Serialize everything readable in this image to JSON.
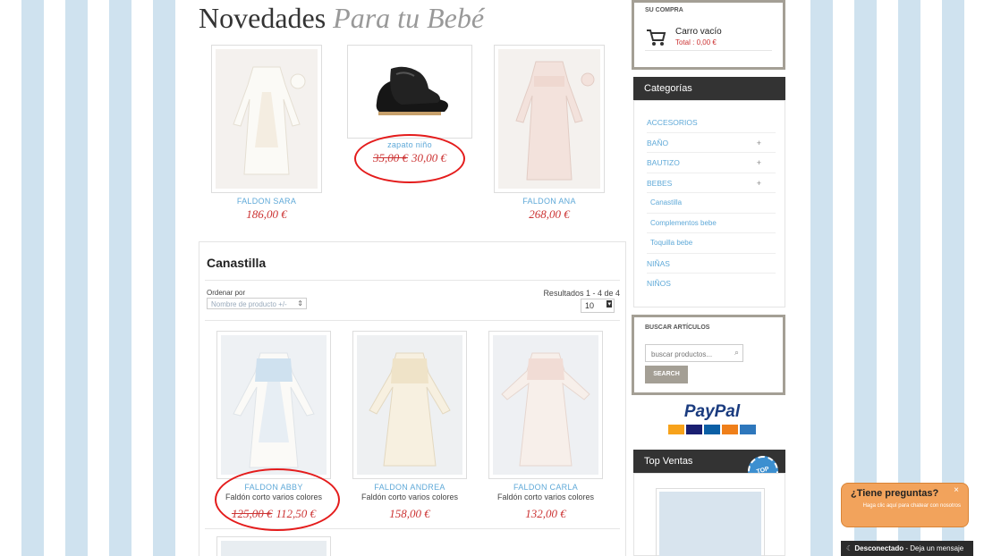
{
  "heading": {
    "main": "Novedades",
    "accent": "Para tu Bebé"
  },
  "featured": [
    {
      "name": "FALDON SARA",
      "price": "186,00 €",
      "old_price": ""
    },
    {
      "name": "zapato niño",
      "price": "30,00 €",
      "old_price": "35,00 €"
    },
    {
      "name": "FALDON ANA",
      "price": "268,00 €",
      "old_price": ""
    }
  ],
  "category": {
    "title": "Canastilla",
    "sort_label": "Ordenar por",
    "sort_value": "Nombre de producto +/-",
    "results": "Resultados 1 - 4 de 4",
    "per_page": "10",
    "products": [
      {
        "name": "FALDON ABBY",
        "desc": "Faldón corto varios colores",
        "price": "112,50 €",
        "old_price": "125,00 €"
      },
      {
        "name": "FALDON ANDREA",
        "desc": "Faldón corto varios colores",
        "price": "158,00 €",
        "old_price": ""
      },
      {
        "name": "FALDON CARLA",
        "desc": "Faldón corto varios colores",
        "price": "132,00 €",
        "old_price": ""
      }
    ]
  },
  "cart": {
    "title": "SU COMPRA",
    "status": "Carro vacío",
    "total": "Total : 0,00 €"
  },
  "categories": {
    "title": "Categorías",
    "items": [
      {
        "label": "ACCESORIOS",
        "expand": ""
      },
      {
        "label": "BAÑO",
        "expand": "+"
      },
      {
        "label": "BAUTIZO",
        "expand": "+"
      },
      {
        "label": "BEBES",
        "expand": "+"
      },
      {
        "label": "Canastilla",
        "expand": ""
      },
      {
        "label": "Complementos bebe",
        "expand": ""
      },
      {
        "label": "Toquilla bebe",
        "expand": ""
      },
      {
        "label": "NIÑAS",
        "expand": ""
      },
      {
        "label": "NIÑOS",
        "expand": ""
      }
    ]
  },
  "search": {
    "title": "BUSCAR ARTÍCULOS",
    "placeholder": "buscar productos...",
    "button": "SEARCH"
  },
  "paypal": {
    "logo": "PayPal",
    "cards": [
      "MasterCard",
      "VISA",
      "Maestro",
      "Discover",
      "AMEX"
    ]
  },
  "top_sales": {
    "title": "Top Ventas",
    "badge": "TOP"
  },
  "chat": {
    "title": "¿Tiene preguntas?",
    "text": "Haga clic aquí para chatear con nosotros",
    "status": "Desconectado",
    "status_msg": "- Deja un mensaje"
  },
  "colors": {
    "accent": "#5fa9d8",
    "price": "#cc3333",
    "highlight_ring": "#e41c1c"
  }
}
